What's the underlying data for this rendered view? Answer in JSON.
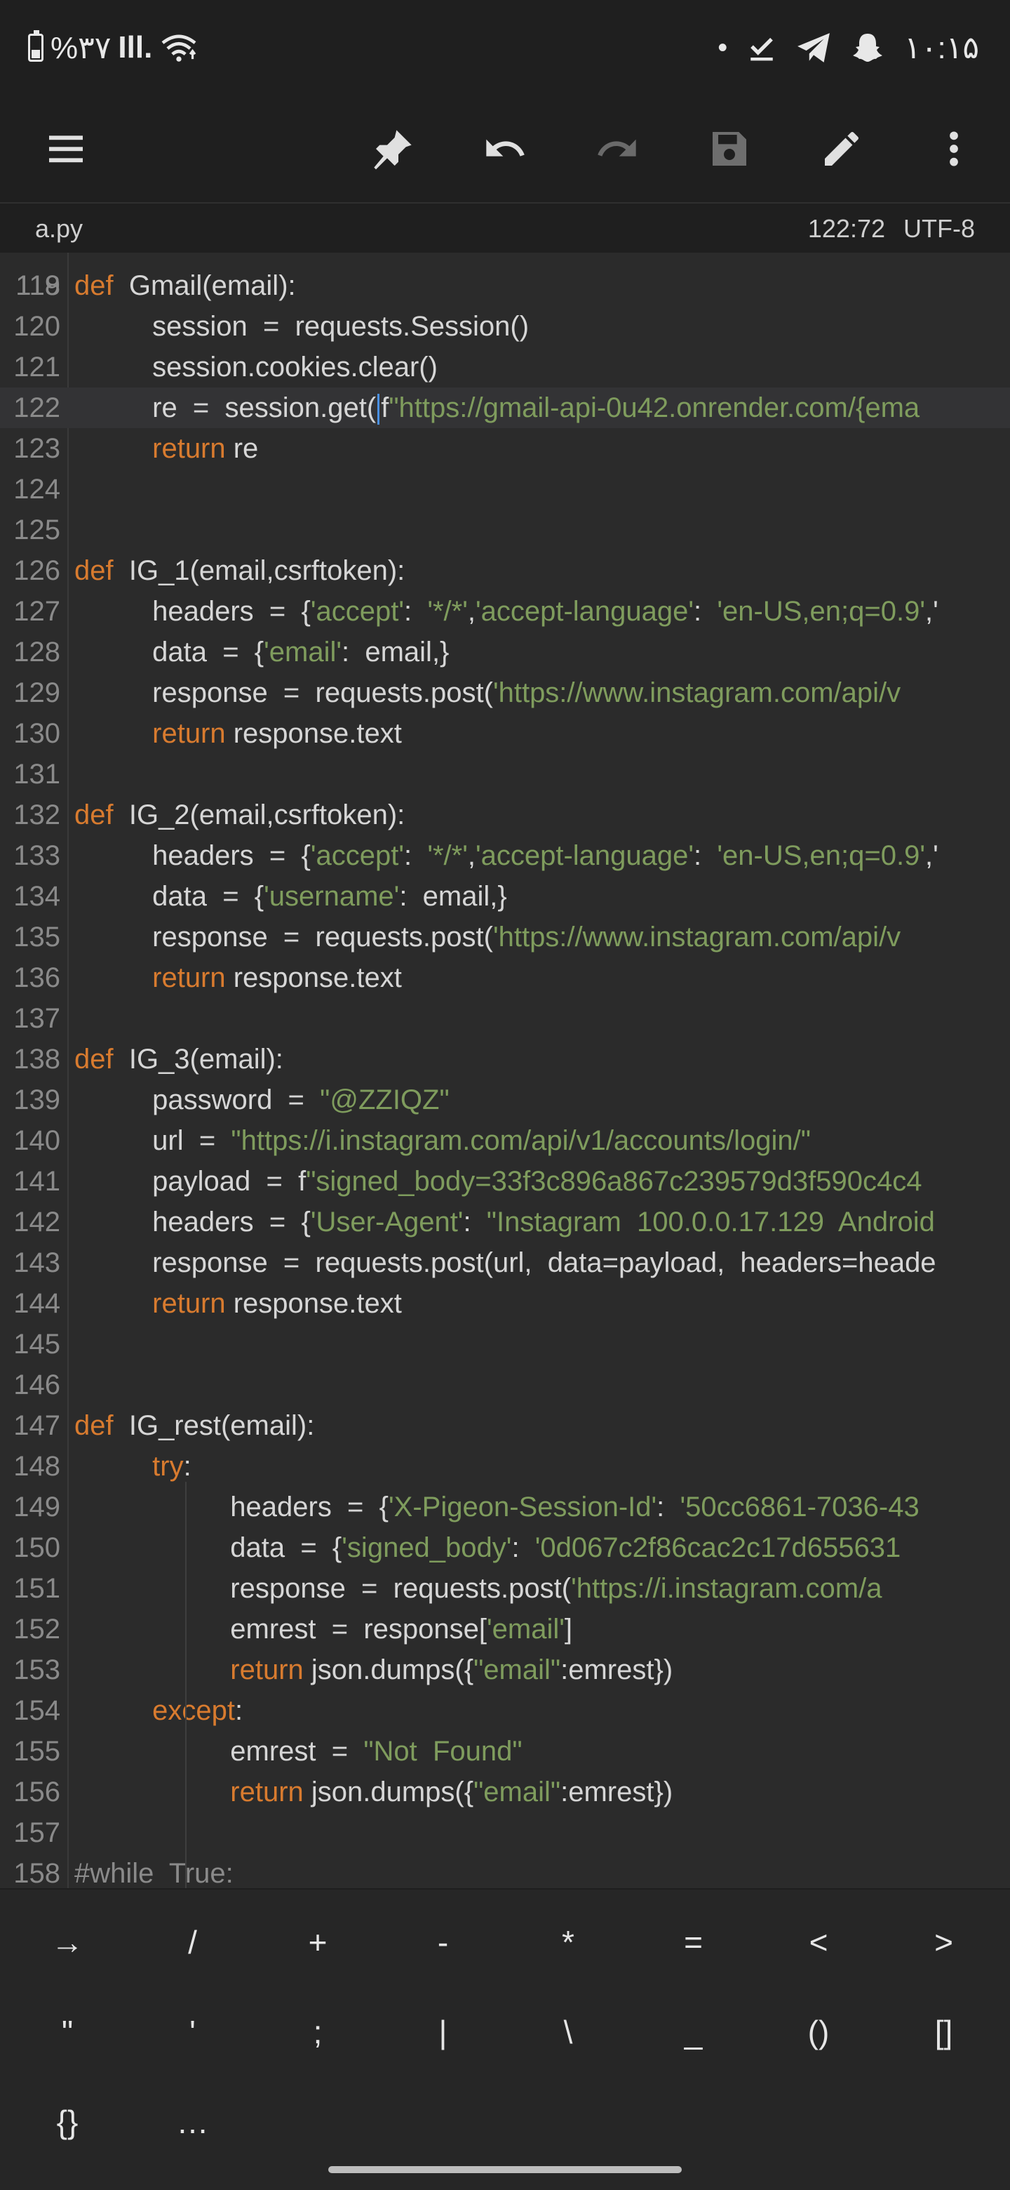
{
  "status_bar": {
    "battery_percent": "%۳۷",
    "signal_text": "Ill.",
    "time": "۱۰:۱۵",
    "dot": "•"
  },
  "toolbar": {
    "icons": [
      "menu-icon",
      "pin-icon",
      "undo-icon",
      "redo-icon",
      "save-icon",
      "edit-icon",
      "more-vert-icon"
    ]
  },
  "file": {
    "name": "a.py",
    "cursor_position": "122:72",
    "encoding": "UTF-8"
  },
  "editor": {
    "partial_top_line": "118",
    "lines": [
      {
        "n": "119",
        "tokens": [
          [
            "kw",
            "def"
          ],
          [
            "",
            "  Gmail(email):"
          ]
        ]
      },
      {
        "n": "120",
        "tokens": [
          [
            "",
            "          session  =  requests.Session()"
          ]
        ]
      },
      {
        "n": "121",
        "tokens": [
          [
            "",
            "          session.cookies.clear()"
          ]
        ]
      },
      {
        "n": "122",
        "current": true,
        "tokens": [
          [
            "",
            "          re  =  session.get("
          ],
          [
            "cursor",
            ""
          ],
          [
            "",
            "f"
          ],
          [
            "str",
            "\"https://gmail-api-0u42.onrender.com/{ema"
          ]
        ]
      },
      {
        "n": "123",
        "tokens": [
          [
            "kw",
            "          return"
          ],
          [
            "",
            " re"
          ]
        ]
      },
      {
        "n": "124",
        "tokens": []
      },
      {
        "n": "125",
        "tokens": []
      },
      {
        "n": "126",
        "tokens": [
          [
            "kw",
            "def"
          ],
          [
            "",
            "  IG_1(email,csrftoken):"
          ]
        ]
      },
      {
        "n": "127",
        "tokens": [
          [
            "",
            "          headers  =  {"
          ],
          [
            "str",
            "'accept'"
          ],
          [
            "",
            ":  "
          ],
          [
            "str",
            "'*/*'"
          ],
          [
            "",
            ","
          ],
          [
            "str",
            "'accept-language'"
          ],
          [
            "",
            ":  "
          ],
          [
            "str",
            "'en-US,en;q=0.9'"
          ],
          [
            "",
            ",'"
          ]
        ]
      },
      {
        "n": "128",
        "tokens": [
          [
            "",
            "          data  =  {"
          ],
          [
            "str",
            "'email'"
          ],
          [
            "",
            ":  email,}"
          ]
        ]
      },
      {
        "n": "129",
        "tokens": [
          [
            "",
            "          response  =  requests.post("
          ],
          [
            "str",
            "'https://www.instagram.com/api/v"
          ]
        ]
      },
      {
        "n": "130",
        "tokens": [
          [
            "kw",
            "          return"
          ],
          [
            "",
            " response.text"
          ]
        ]
      },
      {
        "n": "131",
        "tokens": []
      },
      {
        "n": "132",
        "tokens": [
          [
            "kw",
            "def"
          ],
          [
            "",
            "  IG_2(email,csrftoken):"
          ]
        ]
      },
      {
        "n": "133",
        "tokens": [
          [
            "",
            "          headers  =  {"
          ],
          [
            "str",
            "'accept'"
          ],
          [
            "",
            ":  "
          ],
          [
            "str",
            "'*/*'"
          ],
          [
            "",
            ","
          ],
          [
            "str",
            "'accept-language'"
          ],
          [
            "",
            ":  "
          ],
          [
            "str",
            "'en-US,en;q=0.9'"
          ],
          [
            "",
            ",'"
          ]
        ]
      },
      {
        "n": "134",
        "tokens": [
          [
            "",
            "          data  =  {"
          ],
          [
            "str",
            "'username'"
          ],
          [
            "",
            ":  email,}"
          ]
        ]
      },
      {
        "n": "135",
        "tokens": [
          [
            "",
            "          response  =  requests.post("
          ],
          [
            "str",
            "'https://www.instagram.com/api/v"
          ]
        ]
      },
      {
        "n": "136",
        "tokens": [
          [
            "kw",
            "          return"
          ],
          [
            "",
            " response.text"
          ]
        ]
      },
      {
        "n": "137",
        "tokens": []
      },
      {
        "n": "138",
        "tokens": [
          [
            "kw",
            "def"
          ],
          [
            "",
            "  IG_3(email):"
          ]
        ]
      },
      {
        "n": "139",
        "tokens": [
          [
            "",
            "          password  =  "
          ],
          [
            "str",
            "\"@ZZIQZ\""
          ]
        ]
      },
      {
        "n": "140",
        "tokens": [
          [
            "",
            "          url  =  "
          ],
          [
            "str",
            "\"https://i.instagram.com/api/v1/accounts/login/\""
          ]
        ]
      },
      {
        "n": "141",
        "tokens": [
          [
            "",
            "          payload  =  f"
          ],
          [
            "str",
            "\"signed_body=33f3c896a867c239579d3f590c4c4"
          ]
        ]
      },
      {
        "n": "142",
        "tokens": [
          [
            "",
            "          headers  =  {"
          ],
          [
            "str",
            "'User-Agent'"
          ],
          [
            "",
            ":  "
          ],
          [
            "str",
            "\"Instagram  100.0.0.17.129  Android"
          ]
        ]
      },
      {
        "n": "143",
        "tokens": [
          [
            "",
            "          response  =  requests.post(url,  data=payload,  headers=heade"
          ]
        ]
      },
      {
        "n": "144",
        "tokens": [
          [
            "kw",
            "          return"
          ],
          [
            "",
            " response.text"
          ]
        ]
      },
      {
        "n": "145",
        "tokens": []
      },
      {
        "n": "146",
        "tokens": []
      },
      {
        "n": "147",
        "tokens": [
          [
            "kw",
            "def"
          ],
          [
            "",
            "  IG_rest(email):"
          ]
        ]
      },
      {
        "n": "148",
        "tokens": [
          [
            "kw",
            "          try"
          ],
          [
            "",
            ":"
          ]
        ]
      },
      {
        "n": "149",
        "tokens": [
          [
            "",
            "                    headers  =  {"
          ],
          [
            "str",
            "'X-Pigeon-Session-Id'"
          ],
          [
            "",
            ":  "
          ],
          [
            "str",
            "'50cc6861-7036-43"
          ]
        ]
      },
      {
        "n": "150",
        "tokens": [
          [
            "",
            "                    data  =  {"
          ],
          [
            "str",
            "'signed_body'"
          ],
          [
            "",
            ":  "
          ],
          [
            "str",
            "'0d067c2f86cac2c17d655631"
          ]
        ]
      },
      {
        "n": "151",
        "tokens": [
          [
            "",
            "                    response  =  requests.post("
          ],
          [
            "str",
            "'https://i.instagram.com/a"
          ]
        ]
      },
      {
        "n": "152",
        "tokens": [
          [
            "",
            "                    emrest  =  response["
          ],
          [
            "str",
            "'email'"
          ],
          [
            "",
            "]"
          ]
        ]
      },
      {
        "n": "153",
        "tokens": [
          [
            "kw",
            "                    return"
          ],
          [
            "",
            " json.dumps({"
          ],
          [
            "str",
            "\"email\""
          ],
          [
            "",
            ":emrest})"
          ]
        ]
      },
      {
        "n": "154",
        "tokens": [
          [
            "kw",
            "          except"
          ],
          [
            "",
            ":"
          ]
        ]
      },
      {
        "n": "155",
        "tokens": [
          [
            "",
            "                    emrest  =  "
          ],
          [
            "str",
            "\"Not  Found\""
          ]
        ]
      },
      {
        "n": "156",
        "tokens": [
          [
            "kw",
            "                    return"
          ],
          [
            "",
            " json.dumps({"
          ],
          [
            "str",
            "\"email\""
          ],
          [
            "",
            ":emrest})"
          ]
        ]
      },
      {
        "n": "157",
        "tokens": []
      },
      {
        "n": "158",
        "tokens": [
          [
            "cmt",
            "#while  True:"
          ]
        ]
      }
    ]
  },
  "symbols": {
    "row1": [
      "→",
      "/",
      "+",
      "-",
      "*",
      "=",
      "<",
      ">"
    ],
    "row2": [
      "\"",
      "'",
      ";",
      "|",
      "\\",
      "_",
      "()",
      "[]"
    ],
    "row3": [
      "{}",
      "…"
    ]
  }
}
